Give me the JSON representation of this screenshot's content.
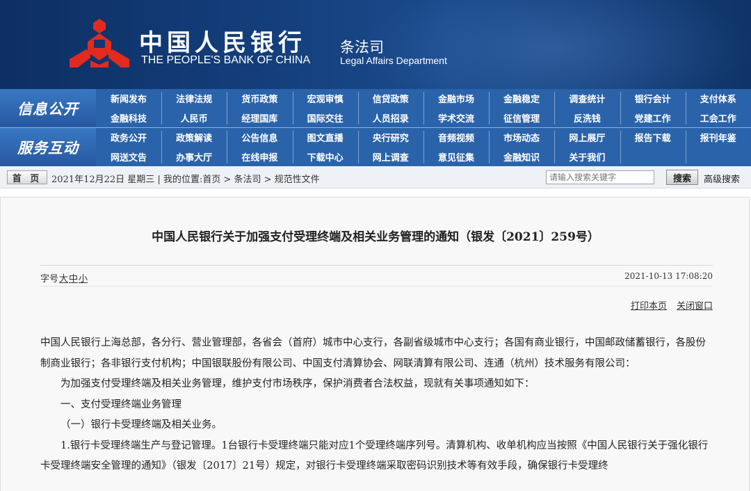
{
  "header": {
    "brand_cn": "中国人民银行",
    "brand_en": "THE PEOPLE'S BANK OF CHINA",
    "dept_cn": "条法司",
    "dept_en": "Legal Affairs Department",
    "logo_color": "#e22b1e"
  },
  "nav": {
    "sections": [
      {
        "label": "信息公开",
        "rows": [
          [
            "新闻发布",
            "法律法规",
            "货币政策",
            "宏观审慎",
            "信贷政策",
            "金融市场",
            "金融稳定",
            "调查统计",
            "银行会计",
            "支付体系"
          ],
          [
            "金融科技",
            "人民币",
            "经理国库",
            "国际交往",
            "人员招录",
            "学术交流",
            "征信管理",
            "反洗钱",
            "党建工作",
            "工会工作"
          ]
        ]
      },
      {
        "label": "服务互动",
        "rows": [
          [
            "政务公开",
            "政策解读",
            "公告信息",
            "图文直播",
            "央行研究",
            "音频视频",
            "市场动态",
            "网上展厅",
            "报告下载",
            "报刊年鉴"
          ],
          [
            "网送文告",
            "办事大厅",
            "在线申报",
            "下载中心",
            "网上调查",
            "意见征集",
            "金融知识",
            "关于我们"
          ]
        ]
      }
    ]
  },
  "crumb": {
    "home": "首 页",
    "text": "2021年12月22日 星期三 | 我的位置:首页 > 条法司 > 规范性文件",
    "search_placeholder": "请输入搜索关键字",
    "search_btn": "搜索",
    "advanced": "高级搜索"
  },
  "article": {
    "title": "中国人民银行关于加强支付受理终端及相关业务管理的通知（银发〔2021〕259号）",
    "fontsize_label": "字号",
    "font_large": "大",
    "font_mid": "中",
    "font_small": "小",
    "datetime": "2021-10-13 17:08:20",
    "print": "打印本页",
    "close": "关闭窗口",
    "paragraphs": [
      "中国人民银行上海总部，各分行、营业管理部，各省会（首府）城市中心支行，各副省级城市中心支行；各国有商业银行，中国邮政储蓄银行，各股份制商业银行；各非银行支付机构；中国银联股份有限公司、中国支付清算协会、网联清算有限公司、连通（杭州）技术服务有限公司：",
      "为加强支付受理终端及相关业务管理，维护支付市场秩序，保护消费者合法权益，现就有关事项通知如下：",
      "一、支付受理终端业务管理",
      "（一）银行卡受理终端及相关业务。",
      "1.银行卡受理终端生产与登记管理。1台银行卡受理终端只能对应1个受理终端序列号。清算机构、收单机构应当按照《中国人民银行关于强化银行卡受理终端安全管理的通知》（银发〔2017〕21号）规定，对银行卡受理终端采取密码识别技术等有效手段，确保银行卡受理终"
    ]
  }
}
